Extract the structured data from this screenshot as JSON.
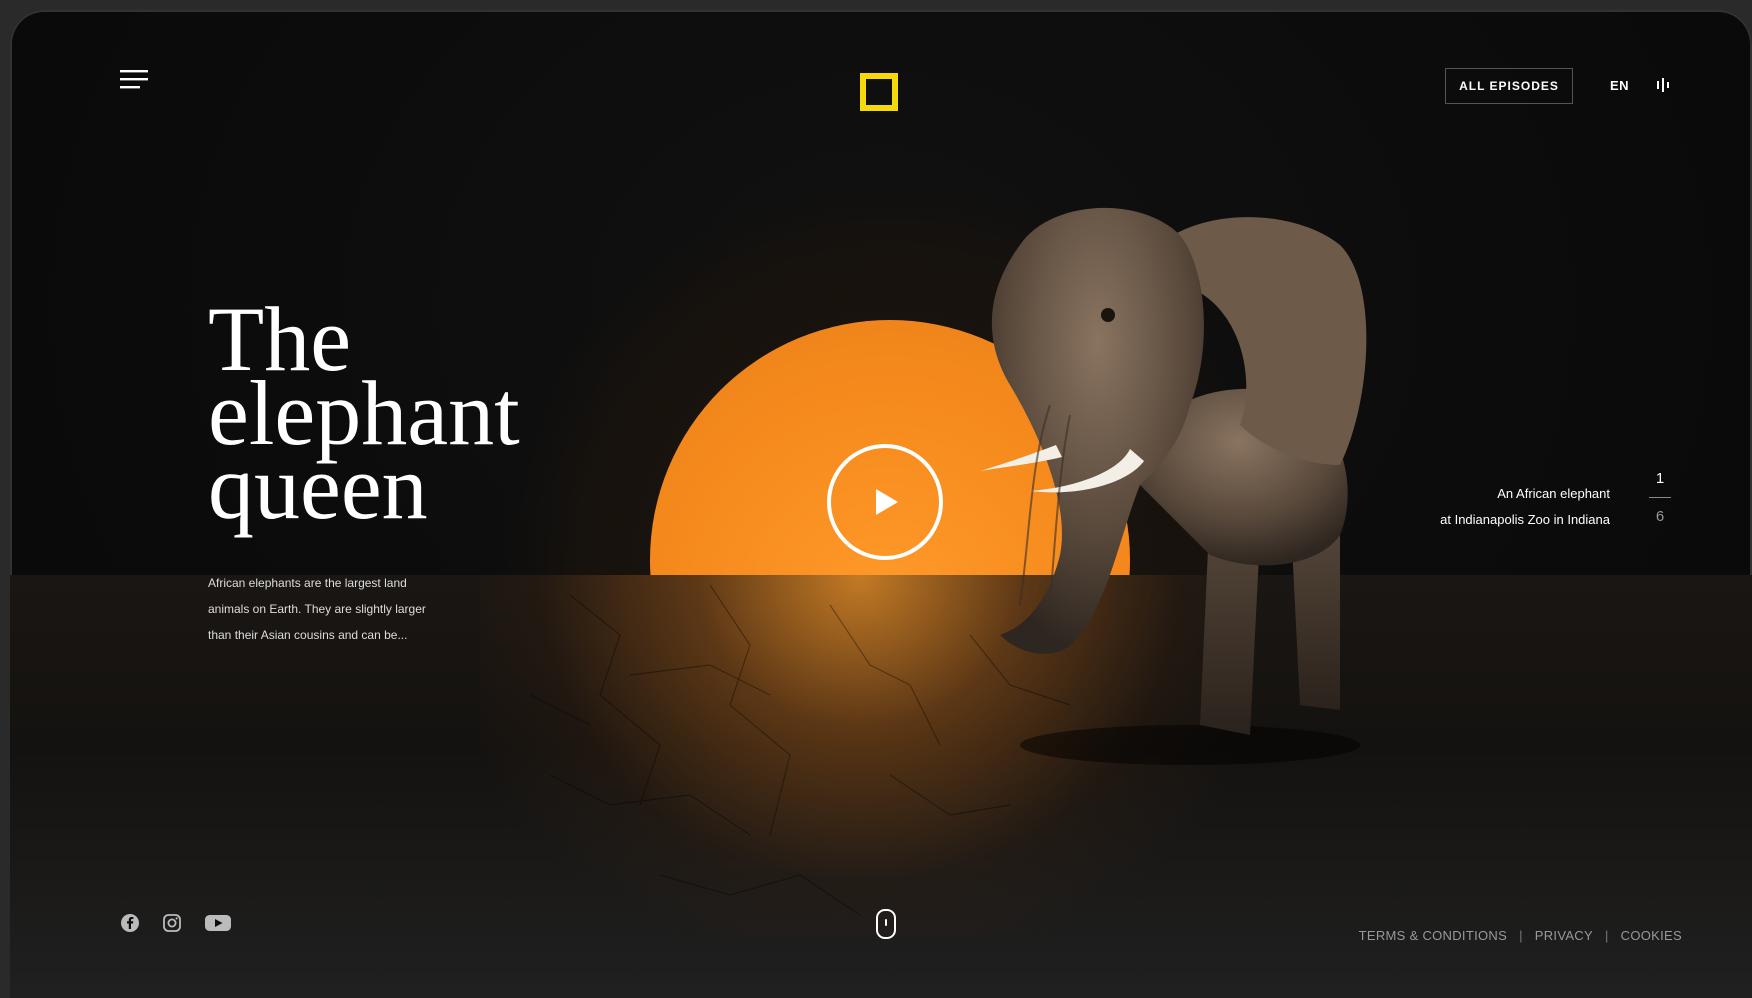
{
  "header": {
    "menu_icon": "hamburger-menu-icon",
    "logo": "yellow-square-logo",
    "logo_color": "#f5d90a",
    "episodes_label": "ALL EPISODES",
    "language": "EN",
    "audio_icon": "audio-bars-icon"
  },
  "hero": {
    "title_line1": "The",
    "title_line2": "elephant",
    "title_line3": "queen",
    "description": "African elephants are the largest land animals on Earth. They are slightly larger than their Asian cousins and can be...",
    "play_icon": "play-icon",
    "accent_color": "#f5891c"
  },
  "slide": {
    "caption_line1": "An African elephant",
    "caption_line2": "at Indianapolis Zoo in Indiana",
    "current": "1",
    "total": "6"
  },
  "social": [
    "facebook-icon",
    "instagram-icon",
    "youtube-icon"
  ],
  "scroll_icon": "mouse-scroll-icon",
  "footer": {
    "terms": "TERMS & CONDITIONS",
    "privacy": "PRIVACY",
    "cookies": "COOKIES",
    "separator": "|"
  }
}
